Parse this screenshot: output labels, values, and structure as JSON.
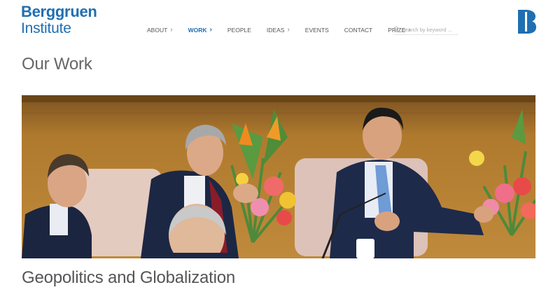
{
  "logo": {
    "line1": "Berggruen",
    "line2": "Institute"
  },
  "nav": {
    "items": [
      {
        "label": "ABOUT",
        "has_submenu": true,
        "active": false
      },
      {
        "label": "WORK",
        "has_submenu": true,
        "active": true
      },
      {
        "label": "PEOPLE",
        "has_submenu": false,
        "active": false
      },
      {
        "label": "IDEAS",
        "has_submenu": true,
        "active": false
      },
      {
        "label": "EVENTS",
        "has_submenu": false,
        "active": false
      },
      {
        "label": "CONTACT",
        "has_submenu": false,
        "active": false
      },
      {
        "label": "PRIZE",
        "has_submenu": true,
        "active": false
      }
    ]
  },
  "search": {
    "placeholder": "search by keyword ..."
  },
  "brand_mark": {
    "letter": "B"
  },
  "page": {
    "title": "Our Work"
  },
  "section": {
    "title": "Geopolitics and Globalization"
  },
  "icons": {
    "search": "search-icon",
    "submenu": "chevron-right-icon",
    "brand": "logo-b-icon"
  },
  "colors": {
    "brand_blue": "#1f6fb2",
    "nav_text": "#555555",
    "title_gray": "#666666"
  }
}
